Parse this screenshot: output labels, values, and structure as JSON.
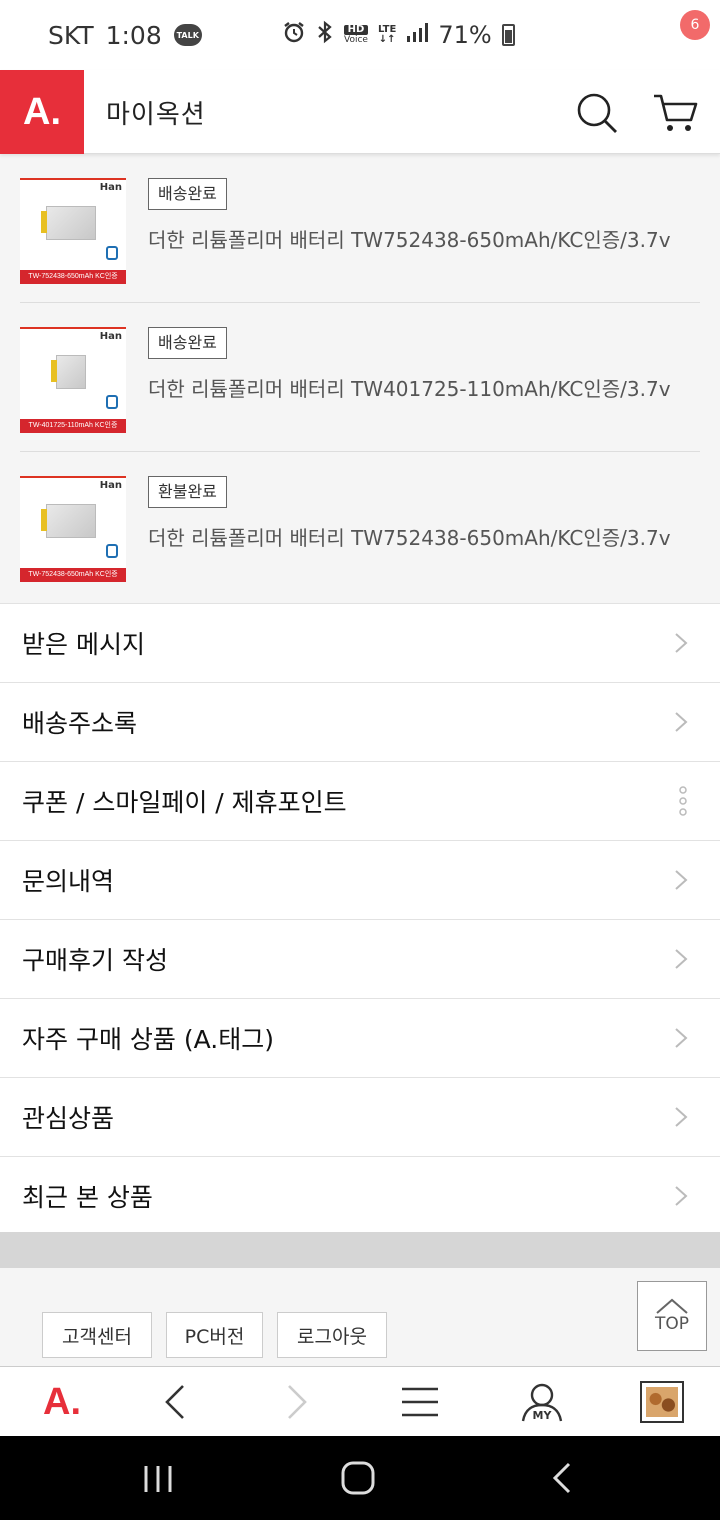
{
  "status_bar": {
    "carrier": "SKT",
    "time": "1:08",
    "talk": "TALK",
    "hd": "HD",
    "voice": "Voice",
    "lte": "LTE",
    "battery": "71%"
  },
  "header": {
    "logo": "A.",
    "title": "마이옥션",
    "cart_count": "6"
  },
  "orders": [
    {
      "status": "배송완료",
      "name": "더한 리튬폴리머 배터리 TW752438-650mAh/KC인증/3.7v",
      "brand": "Han",
      "caption": "TW-752438-650mAh KC인증"
    },
    {
      "status": "배송완료",
      "name": "더한 리튬폴리머 배터리 TW401725-110mAh/KC인증/3.7v",
      "brand": "Han",
      "caption": "TW-401725-110mAh KC인증"
    },
    {
      "status": "환불완료",
      "name": "더한 리튬폴리머 배터리 TW752438-650mAh/KC인증/3.7v",
      "brand": "Han",
      "caption": "TW-752438-650mAh KC인증"
    }
  ],
  "menu": [
    {
      "label": "받은 메시지",
      "icon": "chevron-right-icon"
    },
    {
      "label": "배송주소록",
      "icon": "chevron-right-icon"
    },
    {
      "label": "쿠폰 / 스마일페이 / 제휴포인트",
      "icon": "more-vertical-icon"
    },
    {
      "label": "문의내역",
      "icon": "chevron-right-icon"
    },
    {
      "label": "구매후기 작성",
      "icon": "chevron-right-icon"
    },
    {
      "label": "자주 구매 상품 (A.태그)",
      "icon": "chevron-right-icon"
    },
    {
      "label": "관심상품",
      "icon": "chevron-right-icon"
    },
    {
      "label": "최근 본 상품",
      "icon": "chevron-right-icon"
    }
  ],
  "footer": {
    "customer_center": "고객센터",
    "pc_version": "PC버전",
    "logout": "로그아웃",
    "top": "TOP"
  },
  "bottom_nav": {
    "logo": "A.",
    "my": "MY"
  },
  "colors": {
    "brand_red": "#e72f3a",
    "badge_pink": "#f26a6a"
  }
}
